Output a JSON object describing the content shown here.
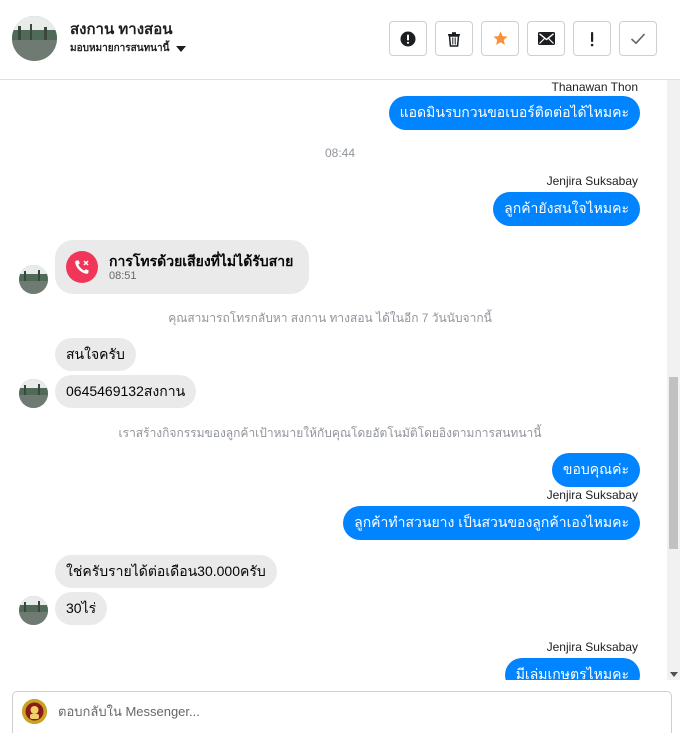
{
  "header": {
    "contact_name": "สงกาน ทางสอน",
    "assign_label": "มอบหมายการสนทนานี้",
    "toolbar": [
      {
        "name": "report-spam-button",
        "icon": "exclamation-circle-icon",
        "highlight": false
      },
      {
        "name": "delete-button",
        "icon": "trash-icon",
        "highlight": false
      },
      {
        "name": "star-button",
        "icon": "star-icon",
        "highlight": true
      },
      {
        "name": "mark-unread-button",
        "icon": "envelope-icon",
        "highlight": false
      },
      {
        "name": "follow-up-button",
        "icon": "exclamation-icon",
        "highlight": false
      },
      {
        "name": "mark-done-button",
        "icon": "check-icon",
        "highlight": false
      }
    ]
  },
  "thread": {
    "m1_sender": "Thanawan Thon",
    "m1_text": "แอดมินรบกวนขอเบอร์ติดต่อได้ไหมคะ",
    "time1": "08:44",
    "m2_sender": "Jenjira Suksabay",
    "m2_text": "ลูกค้ายังสนใจไหมคะ",
    "call": {
      "title": "การโทรด้วยเสียงที่ไม่ได้รับสาย",
      "time": "08:51"
    },
    "notice1": "คุณสามารถโทรกลับหา สงกาน ทางสอน ได้ในอีก 7 วันนับจากนี้",
    "in1": "สนใจครับ",
    "in2": "0645469132สงกาน",
    "notice2": "เราสร้างกิจกรรมของลูกค้าเป้าหมายให้กับคุณโดยอัตโนมัติโดยอิงตามการสนทนานี้",
    "out3": "ขอบคุณค่ะ",
    "m4_sender": "Jenjira Suksabay",
    "m4_text": "ลูกค้าทำสวนยาง เป็นสวนของลูกค้าเองไหมคะ",
    "in3": "ใช่ครับรายได้ต่อเดือน30.000ครับ",
    "in4": "30ไร่",
    "m5_sender": "Jenjira Suksabay",
    "m5_text": "มีเล่มเกษตรไหมคะ"
  },
  "composer": {
    "placeholder": "ตอบกลับใน Messenger..."
  },
  "colors": {
    "outgoing_bubble": "#0084ff",
    "incoming_bubble": "#eaeaea",
    "missed_call": "#f0375a",
    "star": "#f7923a"
  }
}
